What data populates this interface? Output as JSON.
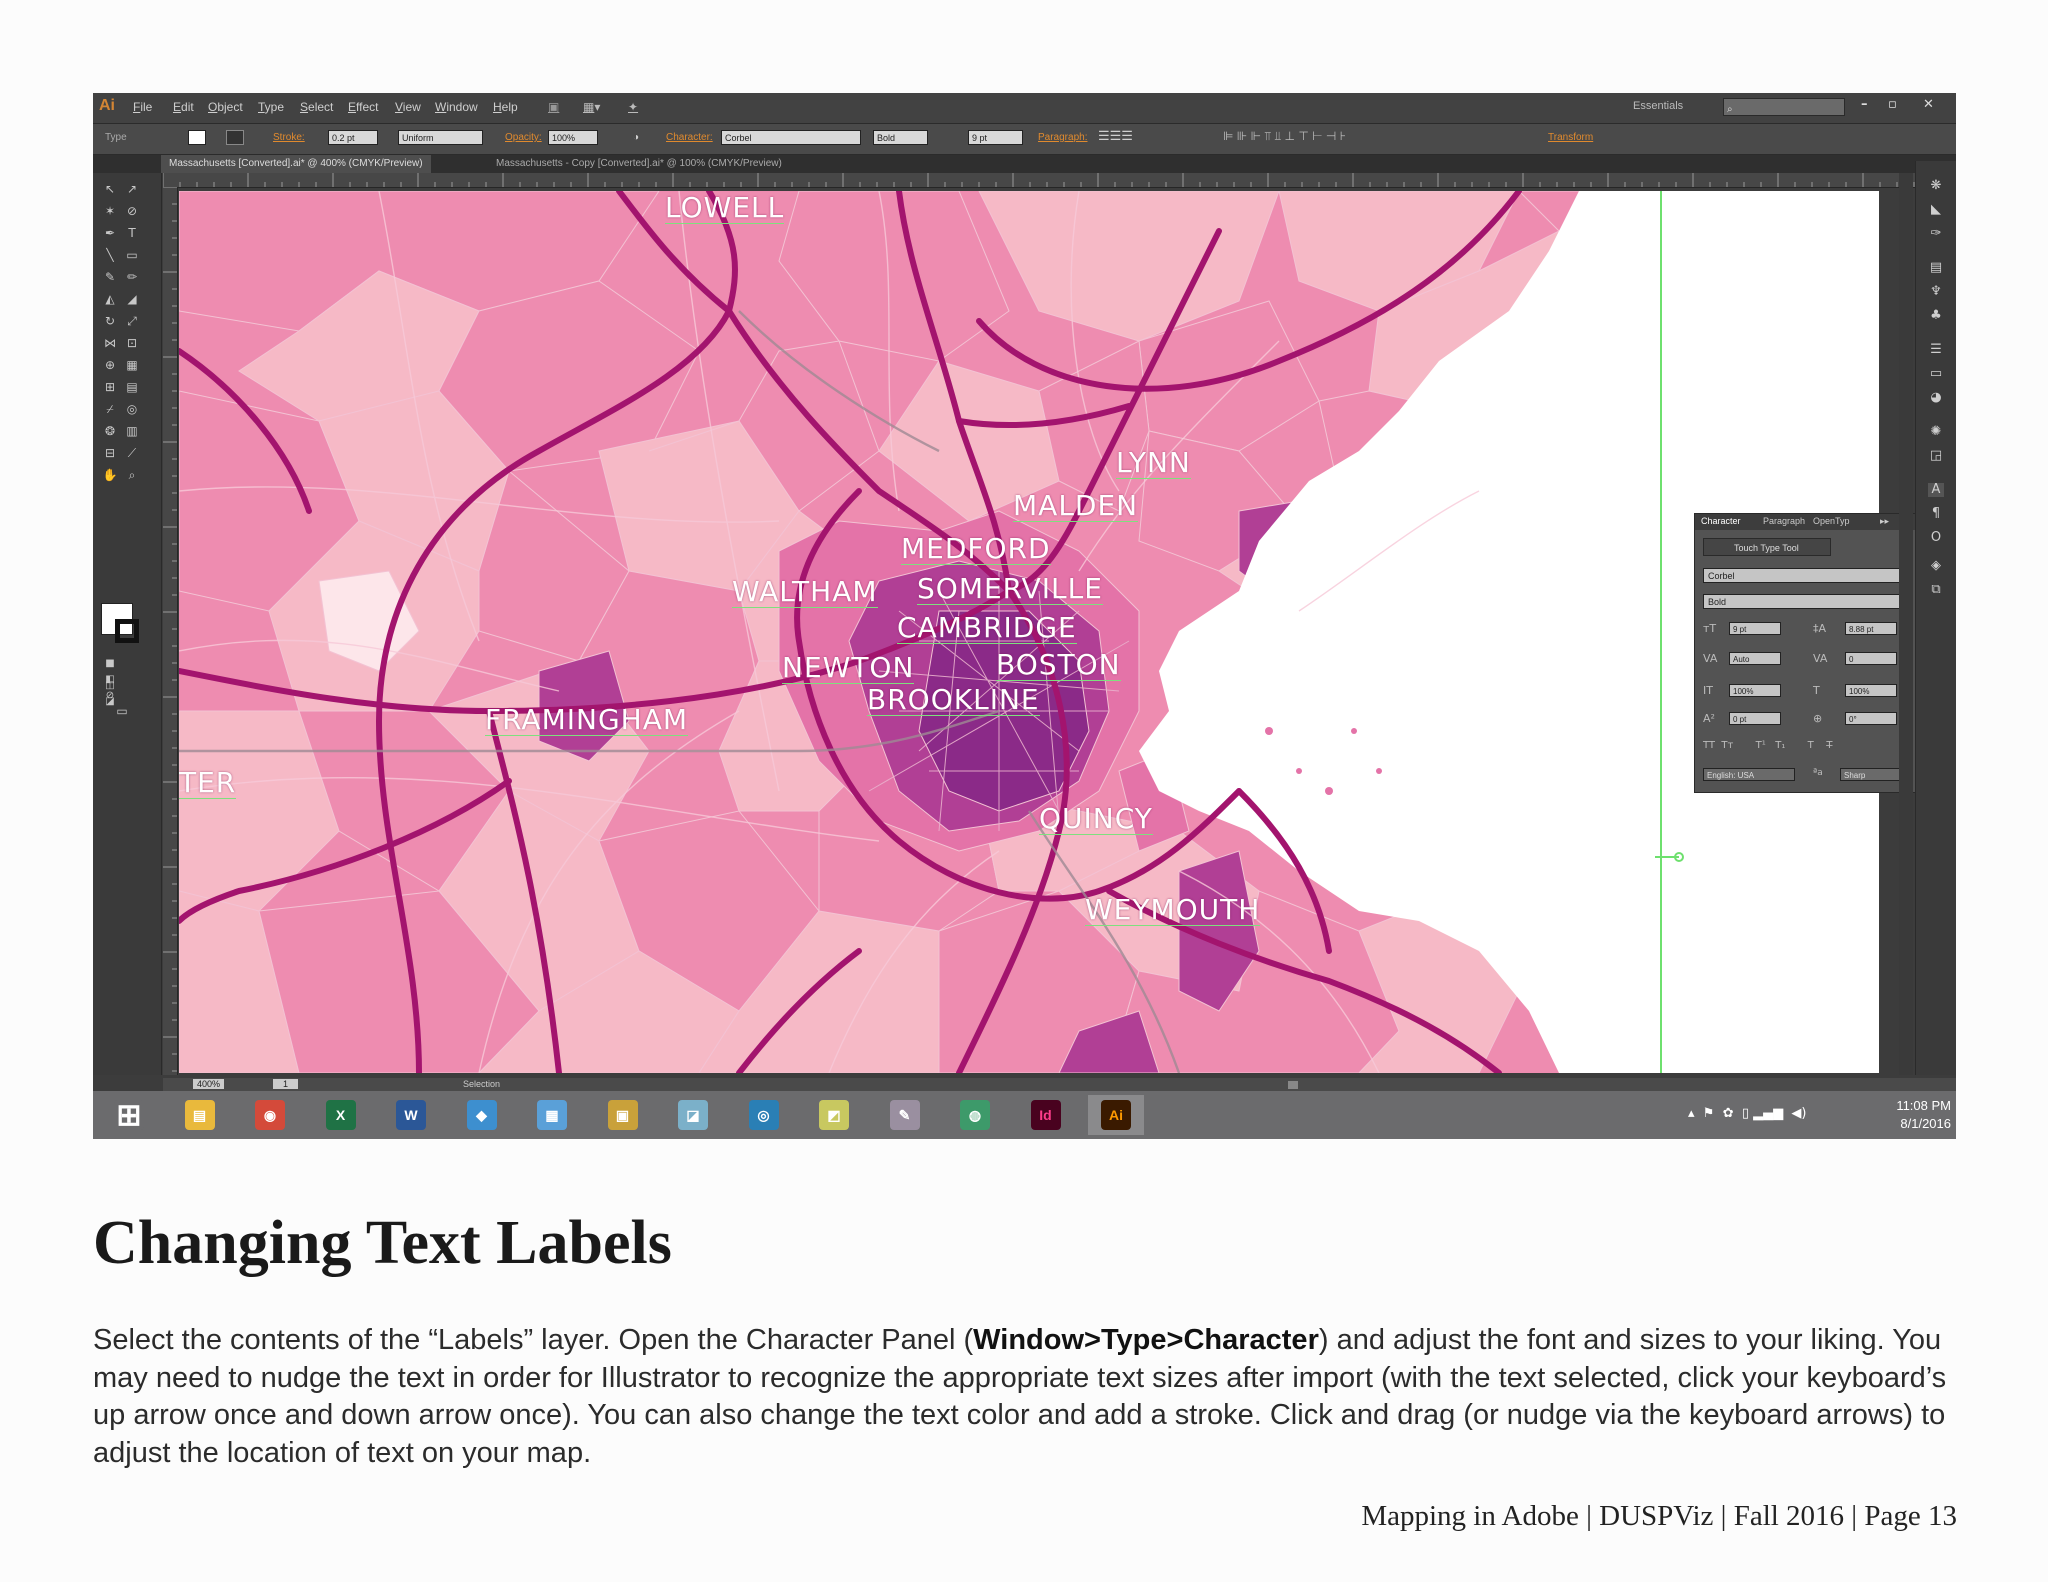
{
  "app": {
    "logo": "Ai",
    "menu": [
      "File",
      "Edit",
      "Object",
      "Type",
      "Select",
      "Effect",
      "View",
      "Window",
      "Help"
    ],
    "workspace": "Essentials",
    "window_buttons": [
      "–",
      "▫",
      "✕"
    ]
  },
  "control_bar": {
    "mode_label": "Type",
    "stroke_label": "Stroke:",
    "stroke_value": "0.2 pt",
    "stroke_profile": "Uniform",
    "opacity_label": "Opacity:",
    "opacity_value": "100%",
    "character_label": "Character:",
    "font_family": "Corbel",
    "font_style": "Bold",
    "font_size": "9 pt",
    "paragraph_label": "Paragraph:",
    "transform_label": "Transform"
  },
  "tabs": [
    {
      "label": "Massachusetts [Converted].ai* @ 400% (CMYK/Preview)",
      "active": true
    },
    {
      "label": "Massachusetts - Copy [Converted].ai* @ 100% (CMYK/Preview)",
      "active": false
    }
  ],
  "status_bar": {
    "zoom": "400%",
    "page": "1",
    "tool": "Selection"
  },
  "map": {
    "colors": {
      "light": "#f6b9c6",
      "mid": "#ee8cb0",
      "strong": "#e473a8",
      "dark": "#b13f95",
      "darkest": "#8b2a88",
      "road": "#a3146e",
      "water": "#ffffff",
      "label_underline": "#7ee07e"
    },
    "labels": [
      "LOWELL",
      "LYNN",
      "MALDEN",
      "MEDFORD",
      "WALTHAM",
      "SOMERVILLE",
      "CAMBRIDGE",
      "NEWTON",
      "BOSTON",
      "BROOKLINE",
      "FRAMINGHAM",
      "TER",
      "QUINCY",
      "WEYMOUTH"
    ]
  },
  "character_panel": {
    "tabs": [
      "Character",
      "Paragraph",
      "OpenTyp"
    ],
    "touch_type": "Touch Type Tool",
    "font_family": "Corbel",
    "font_style": "Bold",
    "font_size": "9 pt",
    "leading": "8.88 pt",
    "kerning": "Auto",
    "tracking": "0",
    "vertical_scale": "100%",
    "horizontal_scale": "100%",
    "baseline_shift": "0 pt",
    "rotation": "0°",
    "language": "English: USA",
    "antialiasing": "Sharp"
  },
  "taskbar": {
    "apps": [
      {
        "name": "windows-start",
        "glyph": "⊞",
        "color": "#6b6b6d"
      },
      {
        "name": "file-explorer",
        "glyph": "▤",
        "color": "#e9b93c"
      },
      {
        "name": "chrome",
        "glyph": "◉",
        "color": "#d44a3a"
      },
      {
        "name": "excel",
        "glyph": "X",
        "color": "#1f7245"
      },
      {
        "name": "word",
        "glyph": "W",
        "color": "#2b5797"
      },
      {
        "name": "app-diamond",
        "glyph": "◆",
        "color": "#3d8fcf"
      },
      {
        "name": "calculator",
        "glyph": "▦",
        "color": "#5aa0d8"
      },
      {
        "name": "app-box",
        "glyph": "▣",
        "color": "#c9a13a"
      },
      {
        "name": "app-sheet",
        "glyph": "◪",
        "color": "#7bb0c9"
      },
      {
        "name": "app-search",
        "glyph": "◎",
        "color": "#2a7fb5"
      },
      {
        "name": "app-folder",
        "glyph": "◩",
        "color": "#c8c860"
      },
      {
        "name": "app-paint",
        "glyph": "✎",
        "color": "#9a8fa0"
      },
      {
        "name": "app-globe",
        "glyph": "◍",
        "color": "#3d9a6a"
      },
      {
        "name": "indesign",
        "glyph": "Id",
        "color": "#49021f"
      },
      {
        "name": "illustrator",
        "glyph": "Ai",
        "color": "#3a1a00"
      }
    ],
    "time": "11:08 PM",
    "date": "8/1/2016"
  },
  "document": {
    "heading": "Changing Text Labels",
    "body_pre": "Select the contents of the “Labels” layer. Open the Character Panel (",
    "body_bold": "Window>Type>Character",
    "body_post": ") and adjust the font and sizes to your liking. You may need to nudge the text in order for Illustrator to recognize the appropriate text sizes after import (with the text selected, click your keyboard’s up arrow once and down arrow once). You can also change the text color and add a stroke. Click and drag (or nudge via the keyboard arrows) to adjust the location of text on your map.",
    "footer": "Mapping in Adobe | DUSPViz | Fall 2016 | Page 13"
  }
}
